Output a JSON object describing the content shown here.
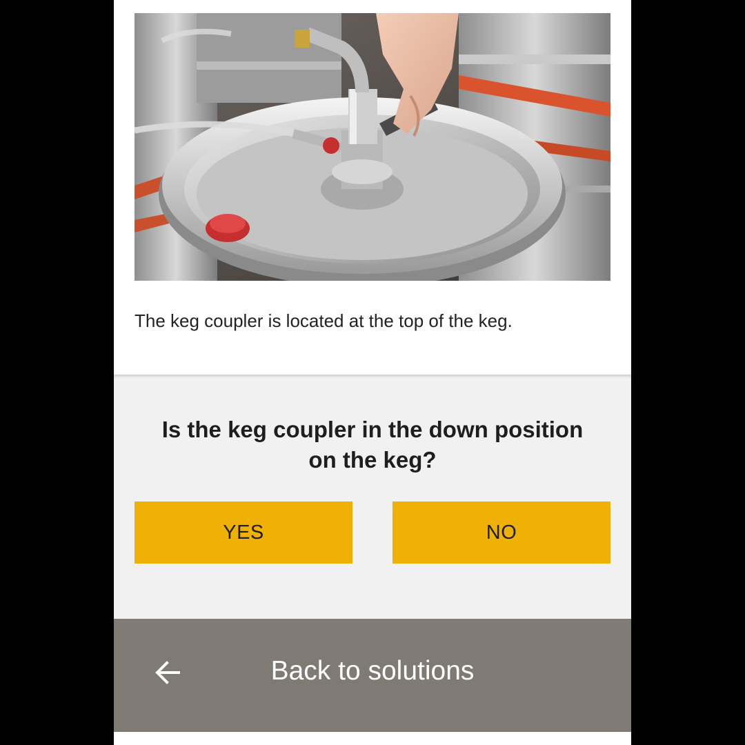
{
  "content": {
    "image_alt": "Hand attaching a keg coupler to the top of a steel keg",
    "caption": "The keg coupler is located at the top of the keg."
  },
  "question_panel": {
    "question": "Is the keg coupler in the down position on the keg?",
    "yes_label": "YES",
    "no_label": "NO"
  },
  "footer": {
    "back_icon": "arrow-left-icon",
    "back_label": "Back to solutions"
  },
  "colors": {
    "accent": "#f0b106",
    "footer_bg": "#7f7a74",
    "panel_bg": "#f1f1f1"
  }
}
